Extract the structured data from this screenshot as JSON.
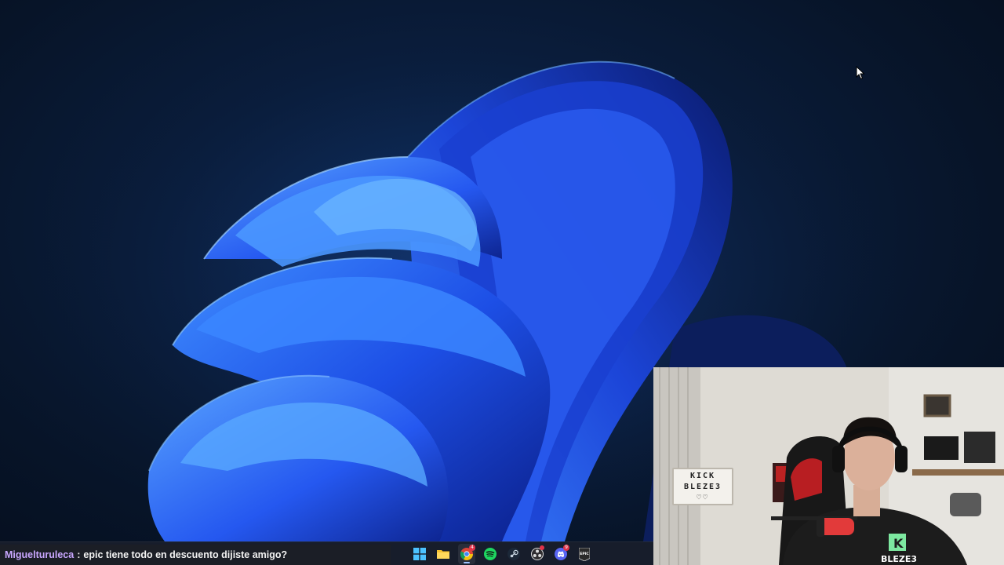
{
  "desktop": {
    "wallpaper": "windows-11-bloom-wallpaper",
    "accent_color": "#2f6bff"
  },
  "chat_overlay": {
    "username": "Miguelturuleca",
    "separator": ":",
    "message": "epic tiene todo en descuento dijiste amigo?",
    "username_color": "#c9a7ff"
  },
  "taskbar": {
    "icons": [
      {
        "name": "windows-start-icon"
      },
      {
        "name": "file-explorer-icon"
      },
      {
        "name": "chrome-icon",
        "badge": "4"
      },
      {
        "name": "spotify-icon"
      },
      {
        "name": "steam-icon"
      },
      {
        "name": "obs-icon"
      },
      {
        "name": "discord-icon",
        "badge": "9"
      },
      {
        "name": "epic-games-icon",
        "label": "EPIC"
      }
    ]
  },
  "webcam": {
    "lightbox_line1": "KICK",
    "lightbox_line2": "BLEZE3",
    "lightbox_line3": "♡♡",
    "shirt_text": "BLEZE3"
  }
}
